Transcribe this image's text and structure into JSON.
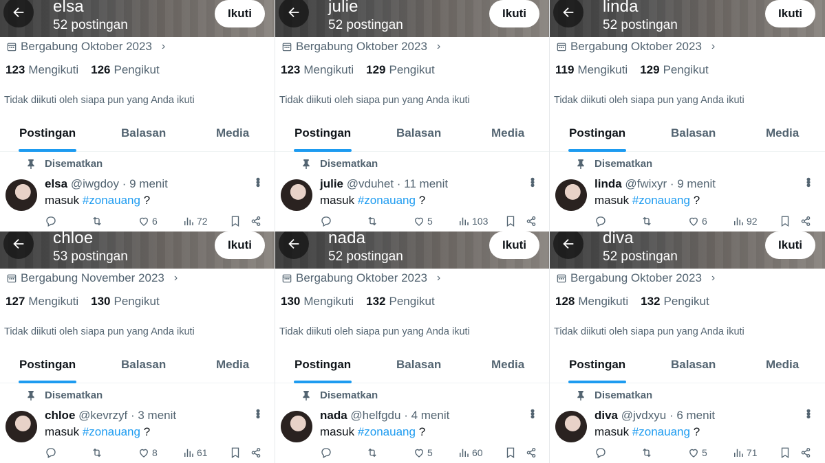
{
  "labels": {
    "follow": "Ikuti",
    "not_followed": "Tidak diikuti oleh siapa pun yang Anda ikuti",
    "following": "Mengikuti",
    "followers": "Pengikut",
    "pinned": "Disematkan",
    "tabs": [
      "Postingan",
      "Balasan",
      "Media"
    ],
    "tweet_prefix": "masuk",
    "tweet_hashtag": "#zonauang",
    "tweet_suffix": "?"
  },
  "colors": {
    "accent": "#1d9bf0",
    "muted": "#536471",
    "text": "#0f1419"
  },
  "panels": [
    {
      "name": "elsa",
      "posts": "52 postingan",
      "joined": "Bergabung Oktober 2023",
      "following": "123",
      "followers": "126",
      "handle": "@iwgdoy",
      "time": "· 9 menit",
      "likes": "6",
      "views": "72"
    },
    {
      "name": "julie",
      "posts": "52 postingan",
      "joined": "Bergabung Oktober 2023",
      "following": "123",
      "followers": "129",
      "handle": "@vduhet",
      "time": "· 11 menit",
      "likes": "5",
      "views": "103"
    },
    {
      "name": "linda",
      "posts": "52 postingan",
      "joined": "Bergabung Oktober 2023",
      "following": "119",
      "followers": "129",
      "handle": "@fwixyr",
      "time": "· 9 menit",
      "likes": "6",
      "views": "92"
    },
    {
      "name": "chloe",
      "posts": "53 postingan",
      "joined": "Bergabung November 2023",
      "following": "127",
      "followers": "130",
      "handle": "@kevrzyf",
      "time": "· 3 menit",
      "likes": "8",
      "views": "61"
    },
    {
      "name": "nada",
      "posts": "52 postingan",
      "joined": "Bergabung Oktober 2023",
      "following": "130",
      "followers": "132",
      "handle": "@helfgdu",
      "time": "· 4 menit",
      "likes": "5",
      "views": "60"
    },
    {
      "name": "diva",
      "posts": "52 postingan",
      "joined": "Bergabung Oktober 2023",
      "following": "128",
      "followers": "132",
      "handle": "@jvdxyu",
      "time": "· 6 menit",
      "likes": "5",
      "views": "71"
    }
  ]
}
